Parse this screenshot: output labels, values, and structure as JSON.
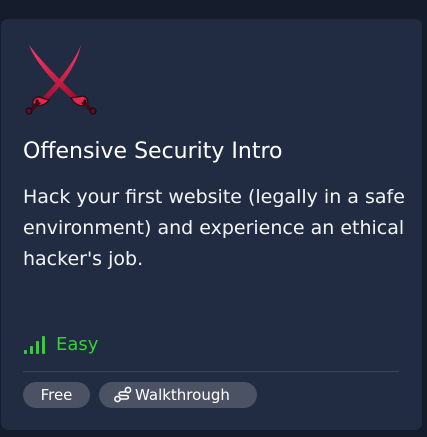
{
  "card": {
    "icon": "crossed-swords-icon",
    "title": "Offensive Security Intro",
    "description": "Hack your first website (legally in a safe environment) and experience an ethical hacker's job.",
    "difficulty": {
      "icon": "signal-bars-icon",
      "label": "Easy",
      "color": "#34d134"
    },
    "tags": [
      {
        "label": "Free"
      },
      {
        "icon": "walkthrough-path-icon",
        "label": "Walkthrough"
      }
    ]
  },
  "colors": {
    "page_background": "#151c2b",
    "card_background": "#212c42",
    "tag_background": "#4a5263",
    "sword_red": "#d0103f"
  }
}
